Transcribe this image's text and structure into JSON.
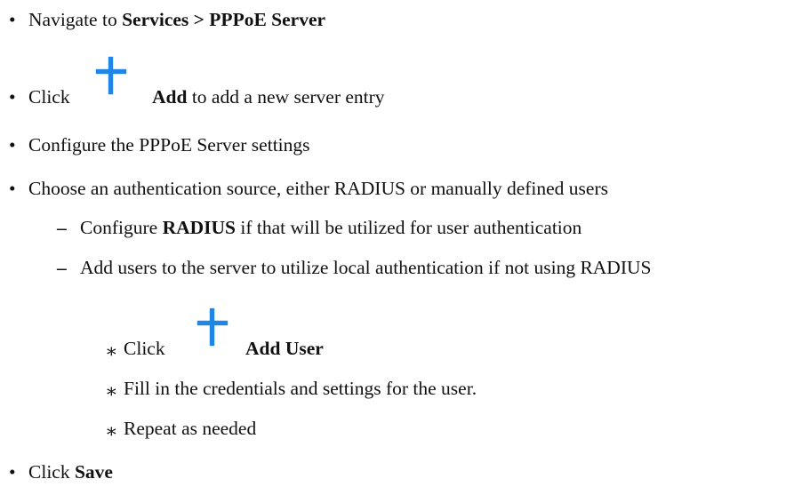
{
  "steps": {
    "s1": {
      "bullet": "•",
      "pre": "Navigate to ",
      "bold": "Services > PPPoE Server"
    },
    "s2": {
      "bullet": "•",
      "pre": "Click",
      "bold": "Add",
      "post": " to add a new server entry",
      "icon": "plus-icon"
    },
    "s3": {
      "bullet": "•",
      "text": "Configure the PPPoE Server settings"
    },
    "s4": {
      "bullet": "•",
      "text": "Choose an authentication source, either RADIUS or manually defined users"
    },
    "s4a": {
      "bullet": "–",
      "pre": "Configure ",
      "bold": "RADIUS",
      "post": " if that will be utilized for user authentication"
    },
    "s4b": {
      "bullet": "–",
      "text": "Add users to the server to utilize local authentication if not using RADIUS"
    },
    "s4b1": {
      "bullet": "∗",
      "pre": "Click",
      "bold": "Add User",
      "icon": "plus-icon"
    },
    "s4b2": {
      "bullet": "∗",
      "text": "Fill in the credentials and settings for the user."
    },
    "s4b3": {
      "bullet": "∗",
      "text": "Repeat as needed"
    },
    "s5": {
      "bullet": "•",
      "pre": "Click ",
      "bold": "Save"
    }
  },
  "colors": {
    "icon": "#1f86e6",
    "text": "#111111"
  }
}
